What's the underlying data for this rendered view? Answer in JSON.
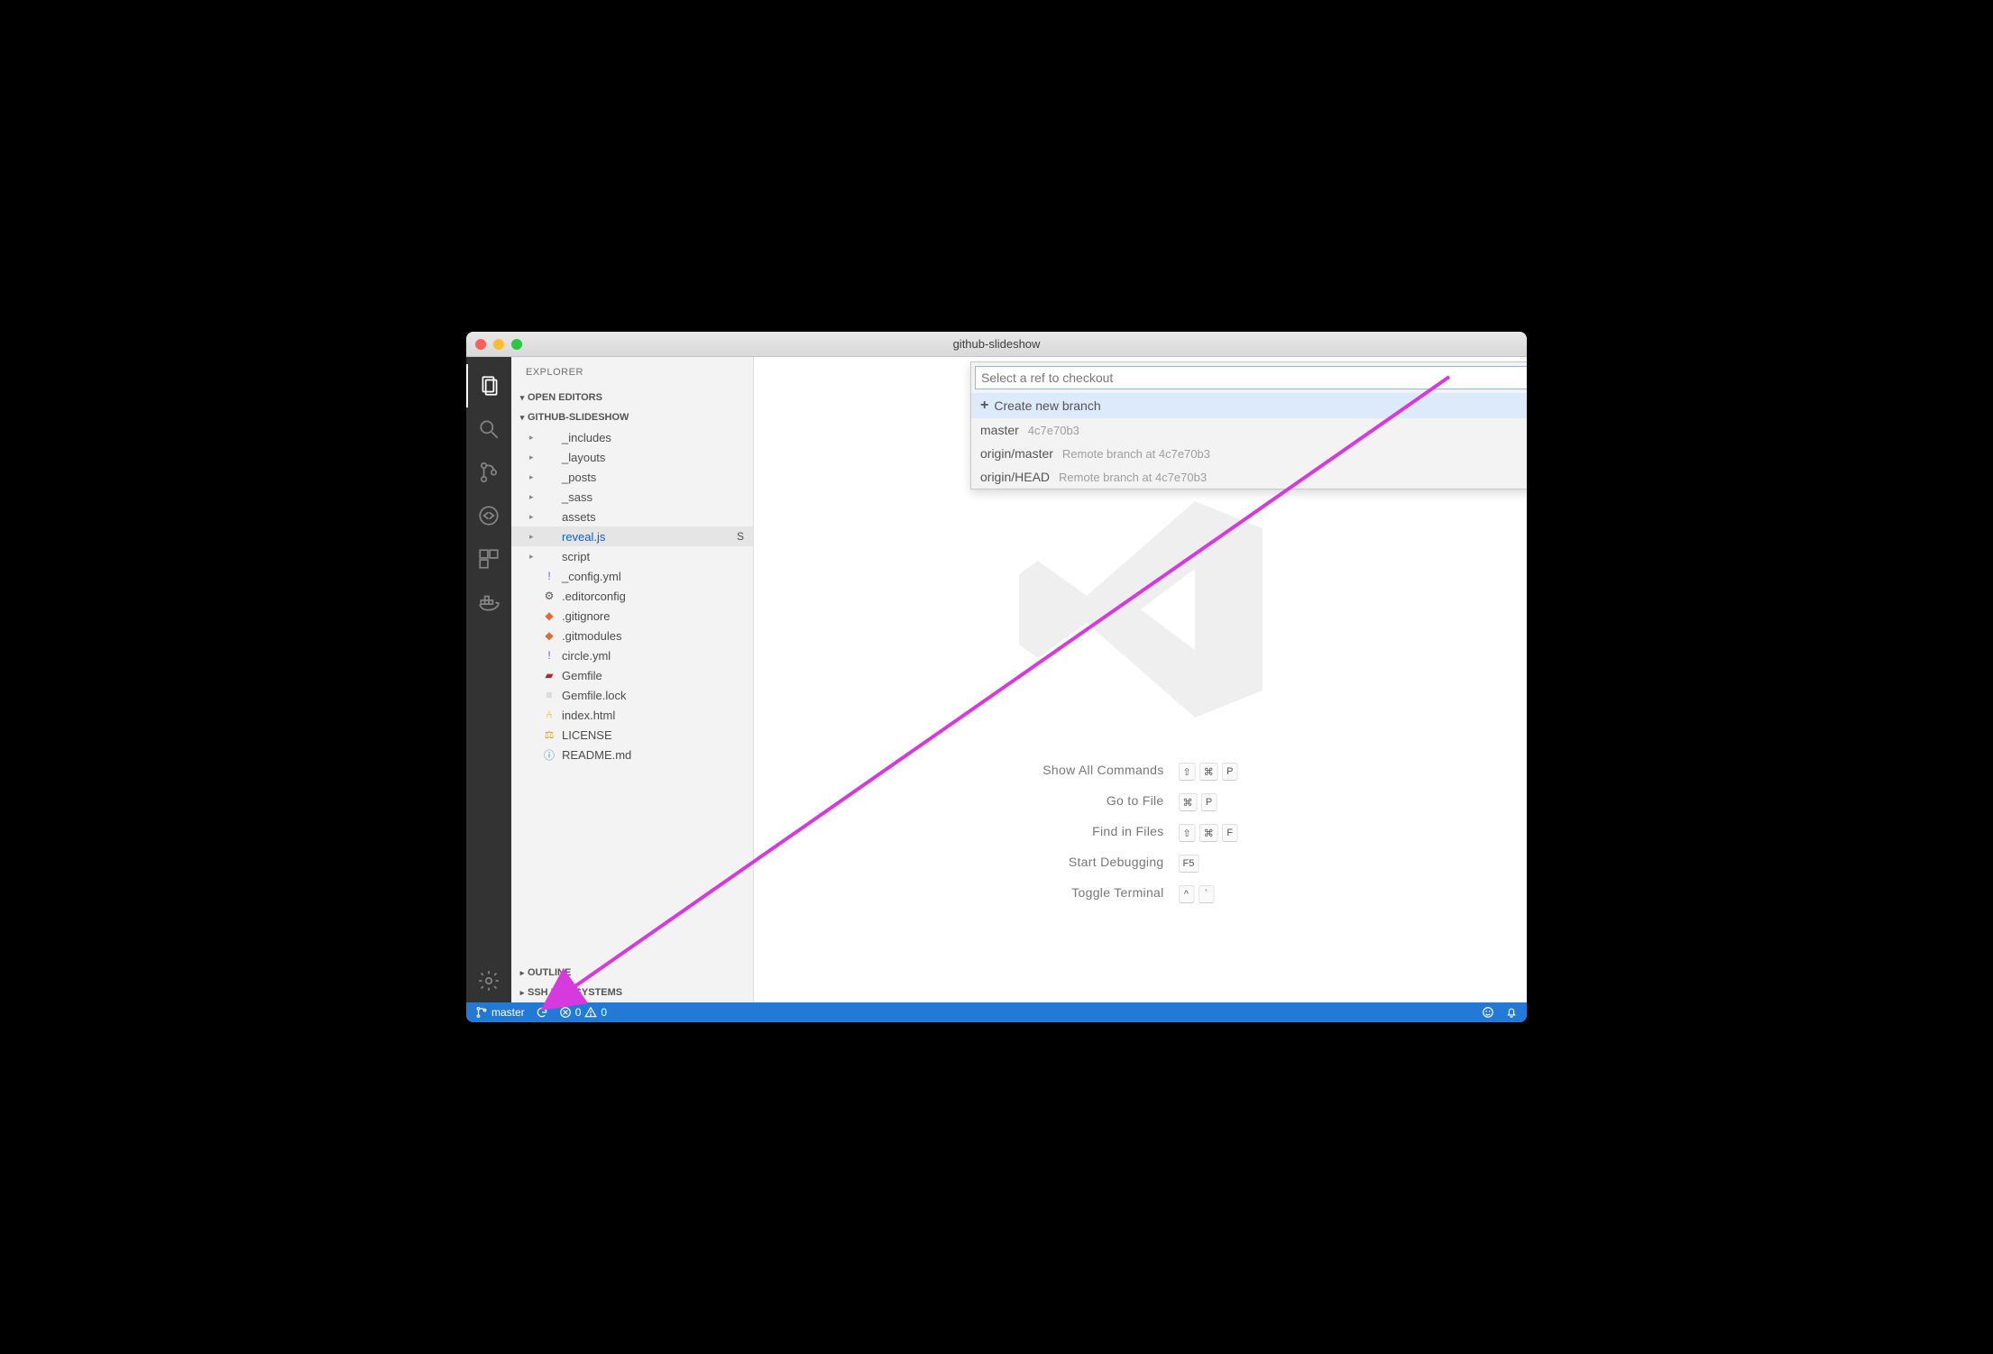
{
  "window": {
    "title": "github-slideshow"
  },
  "sidebar": {
    "title": "EXPLORER",
    "sections": {
      "openEditors": "OPEN EDITORS",
      "repo": "GITHUB-SLIDESHOW",
      "outline": "OUTLINE",
      "ssh": "SSH FILE SYSTEMS"
    },
    "tree": [
      {
        "label": "_includes",
        "type": "folder"
      },
      {
        "label": "_layouts",
        "type": "folder"
      },
      {
        "label": "_posts",
        "type": "folder"
      },
      {
        "label": "_sass",
        "type": "folder"
      },
      {
        "label": "assets",
        "type": "folder"
      },
      {
        "label": "reveal.js",
        "type": "folder",
        "active": true,
        "badge": "S"
      },
      {
        "label": "script",
        "type": "folder"
      },
      {
        "label": "_config.yml",
        "type": "file",
        "icon": "!",
        "iconColor": "#6a5acd"
      },
      {
        "label": ".editorconfig",
        "type": "file",
        "icon": "⚙",
        "iconColor": "#555"
      },
      {
        "label": ".gitignore",
        "type": "file",
        "icon": "◆",
        "iconColor": "#e9692c"
      },
      {
        "label": ".gitmodules",
        "type": "file",
        "icon": "◆",
        "iconColor": "#e9692c"
      },
      {
        "label": "circle.yml",
        "type": "file",
        "icon": "!",
        "iconColor": "#6a5acd"
      },
      {
        "label": "Gemfile",
        "type": "file",
        "icon": "▰",
        "iconColor": "#a03030"
      },
      {
        "label": "Gemfile.lock",
        "type": "file",
        "icon": "≡",
        "iconColor": "#bbb"
      },
      {
        "label": "index.html",
        "type": "file",
        "icon": "⑃",
        "iconColor": "#d4a017"
      },
      {
        "label": "LICENSE",
        "type": "file",
        "icon": "⚖",
        "iconColor": "#d4a017"
      },
      {
        "label": "README.md",
        "type": "file",
        "icon": "ⓘ",
        "iconColor": "#3a87cf"
      }
    ]
  },
  "quickpick": {
    "placeholder": "Select a ref to checkout",
    "value": "",
    "items": [
      {
        "label": "Create new branch",
        "plus": true,
        "selected": true
      },
      {
        "label": "master",
        "detail": "4c7e70b3"
      },
      {
        "label": "origin/master",
        "detail": "Remote branch at 4c7e70b3"
      },
      {
        "label": "origin/HEAD",
        "detail": "Remote branch at 4c7e70b3"
      }
    ]
  },
  "quicklinks": [
    {
      "label": "Show All Commands",
      "keys": [
        "⇧",
        "⌘",
        "P"
      ]
    },
    {
      "label": "Go to File",
      "keys": [
        "⌘",
        "P"
      ]
    },
    {
      "label": "Find in Files",
      "keys": [
        "⇧",
        "⌘",
        "F"
      ]
    },
    {
      "label": "Start Debugging",
      "keys": [
        "F5"
      ]
    },
    {
      "label": "Toggle Terminal",
      "keys": [
        "^",
        "`"
      ]
    }
  ],
  "statusbar": {
    "branch": "master",
    "errors": "0",
    "warnings": "0"
  }
}
